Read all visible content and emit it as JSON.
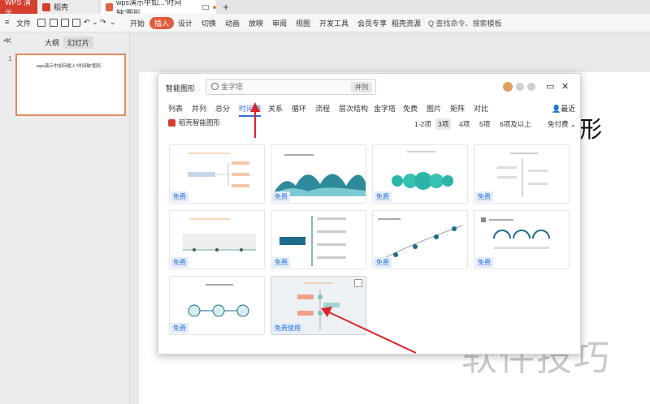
{
  "titlebar": {
    "tabs": [
      "WPS 演示",
      "稻壳",
      "wps演示中如...“时间轴”图形"
    ],
    "new_tab": "+"
  },
  "menubar": {
    "file": "文件",
    "items": [
      "开始",
      "插入",
      "设计",
      "切换",
      "动画",
      "放映",
      "审阅",
      "视图",
      "开发工具",
      "会员专享",
      "稻壳资源"
    ],
    "active_index": 1,
    "search": "Q 查找命令、搜索模板"
  },
  "leftpane": {
    "collapse": "≪",
    "tabs": [
      "大纲",
      "幻灯片"
    ],
    "slide_number": "1",
    "slide_thumb_text": "wps演示中如何插入“时间轴”图形"
  },
  "slide": {
    "visible_text": "形",
    "watermark": "软件技巧"
  },
  "dialog": {
    "title": "智能图形",
    "search_placeholder": "金字塔",
    "search_tag": "并列",
    "categories": [
      "列表",
      "并列",
      "总分",
      "时间轴",
      "关系",
      "循环",
      "流程",
      "层次结构",
      "金字塔",
      "免费",
      "图片",
      "矩阵",
      "对比"
    ],
    "active_category": 3,
    "recent": "最近",
    "brand": "稻壳智能图形",
    "filters": [
      "1-2项",
      "3项",
      "4项",
      "5项",
      "6项及以上"
    ],
    "active_filter": 1,
    "price_filter": "免付费",
    "cards": [
      {
        "badge": "免费"
      },
      {
        "badge": "免费"
      },
      {
        "badge": "免费"
      },
      {
        "badge": "免费"
      },
      {
        "badge": "免费"
      },
      {
        "badge": "免费"
      },
      {
        "badge": "免费"
      },
      {
        "badge": "免费"
      },
      {
        "badge": "免费"
      },
      {
        "badge": "免费使用"
      }
    ]
  },
  "colors": {
    "brand_red": "#d63f2d",
    "insert_active": "#e35a3c",
    "accent_blue": "#2f6fe0",
    "arrow_red": "#d9252a"
  }
}
